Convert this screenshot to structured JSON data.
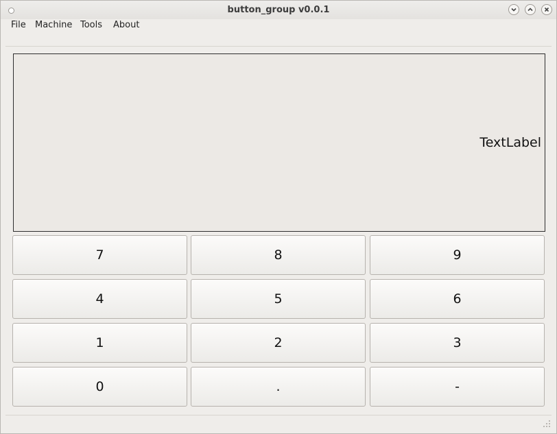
{
  "window": {
    "title": "button_group v0.0.1"
  },
  "menubar": {
    "items": [
      "File",
      "Machine",
      "Tools",
      "About"
    ]
  },
  "display": {
    "label": "TextLabel"
  },
  "keypad": {
    "rows": [
      [
        "7",
        "8",
        "9"
      ],
      [
        "4",
        "5",
        "6"
      ],
      [
        "1",
        "2",
        "3"
      ],
      [
        "0",
        ".",
        "-"
      ]
    ]
  },
  "icons": {
    "window_dot": "window-menu-icon",
    "minimize": "chevron-down-icon",
    "maximize": "chevron-up-icon",
    "close": "close-icon",
    "resize_grip": "resize-grip-icon"
  }
}
